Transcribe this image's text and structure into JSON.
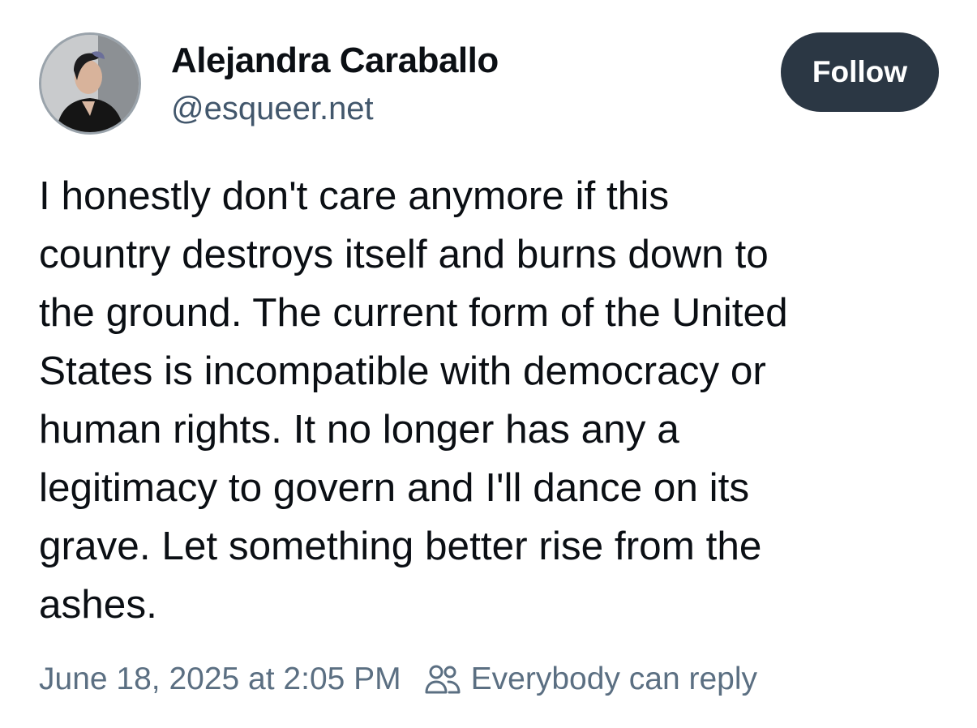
{
  "author": {
    "display_name": "Alejandra Caraballo",
    "handle": "@esqueer.net",
    "avatar_icon": "profile-photo"
  },
  "actions": {
    "follow_label": "Follow"
  },
  "post": {
    "text_lines": [
      "I honestly don't care anymore if this",
      "country destroys itself and burns down to",
      "the ground. The current form of the United",
      "States is incompatible with democracy or",
      "human rights. It no longer has any a",
      "legitimacy to govern and I'll dance on its",
      "grave. Let something better rise from the",
      "ashes."
    ],
    "timestamp": "June 18, 2025 at 2:05 PM",
    "reply_setting": "Everybody can reply",
    "reply_icon": "people-icon"
  },
  "colors": {
    "text": "#0b0f14",
    "muted": "#5b6f82",
    "handle": "#42576c",
    "button_bg": "#2b3744",
    "button_text": "#ffffff"
  }
}
